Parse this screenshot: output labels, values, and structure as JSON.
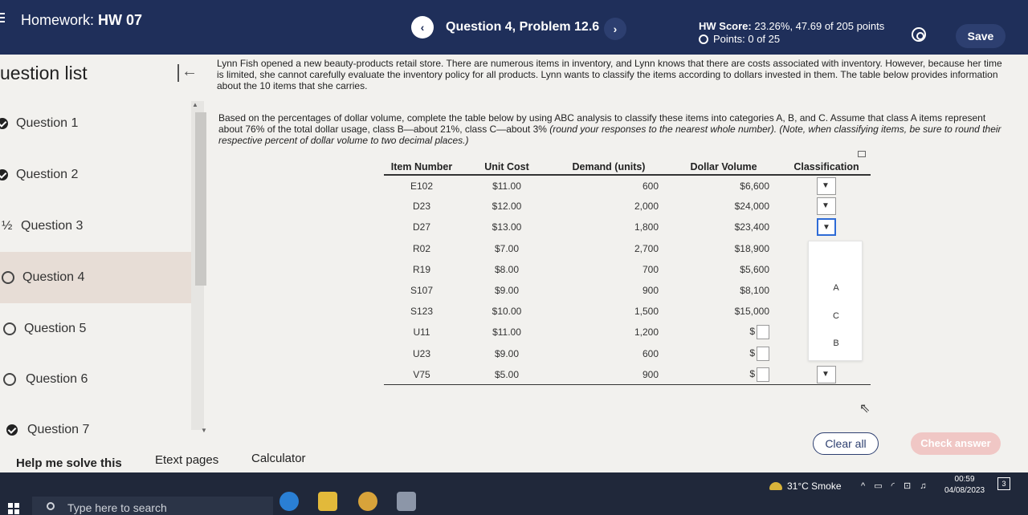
{
  "header": {
    "hw_prefix": "Homework:",
    "hw_name": "HW 07",
    "prev_icon": "‹",
    "next_icon": "›",
    "question_title": "Question 4, Problem 12.6",
    "score_label": "HW Score:",
    "score_value": "23.26%, 47.69 of 205 points",
    "points": "Points: 0 of 25",
    "save_label": "Save",
    "colors": {
      "bar": "#1f2f5a",
      "button": "#2d3f70"
    }
  },
  "sidebar": {
    "title": "uestion list",
    "items": [
      {
        "label": "Question 1",
        "status": "check"
      },
      {
        "label": "Question 2",
        "status": "check"
      },
      {
        "label": "Question 3",
        "status": "partial"
      },
      {
        "label": "Question 4",
        "status": "open"
      },
      {
        "label": "Question 5",
        "status": "open"
      },
      {
        "label": "Question 6",
        "status": "open"
      },
      {
        "label": "Question 7",
        "status": "check"
      }
    ]
  },
  "problem": {
    "para1": "Lynn Fish opened a new beauty-products retail store. There are numerous items in inventory, and Lynn knows that there are costs associated with inventory. However, because her time is limited, she cannot carefully evaluate the inventory policy for all products. Lynn wants to classify the items according to dollars invested in them. The table below provides information about the 10 items that she carries.",
    "para2_main": "Based on the percentages of dollar volume, complete the table below by using ABC analysis to classify these items into categories A, B, and C. Assume that class A items represent about 76% of the total dollar usage, class B—about 21%, class C—about 3% ",
    "para2_italic": "(round your responses to the nearest whole number). (Note, when classifying items, be sure to round their respective percent of dollar volume to two decimal places.)"
  },
  "table": {
    "headers": [
      "Item Number",
      "Unit Cost",
      "Demand (units)",
      "Dollar Volume",
      "Classification"
    ],
    "rows": [
      {
        "item": "E102",
        "cost": "$11.00",
        "demand": "600",
        "volume": "$6,600",
        "cls": "dropdown"
      },
      {
        "item": "D23",
        "cost": "$12.00",
        "demand": "2,000",
        "volume": "$24,000",
        "cls": "dropdown"
      },
      {
        "item": "D27",
        "cost": "$13.00",
        "demand": "1,800",
        "volume": "$23,400",
        "cls": "dropdown-focus"
      },
      {
        "item": "R02",
        "cost": "$7.00",
        "demand": "2,700",
        "volume": "$18,900",
        "cls": ""
      },
      {
        "item": "R19",
        "cost": "$8.00",
        "demand": "700",
        "volume": "$5,600",
        "cls": ""
      },
      {
        "item": "S107",
        "cost": "$9.00",
        "demand": "900",
        "volume": "$8,100",
        "cls": ""
      },
      {
        "item": "S123",
        "cost": "$10.00",
        "demand": "1,500",
        "volume": "$15,000",
        "cls": ""
      },
      {
        "item": "U11",
        "cost": "$11.00",
        "demand": "1,200",
        "volume": "$",
        "cls": ""
      },
      {
        "item": "U23",
        "cost": "$9.00",
        "demand": "600",
        "volume": "$",
        "cls": ""
      },
      {
        "item": "V75",
        "cost": "$5.00",
        "demand": "900",
        "volume": "$",
        "cls": "dropdown"
      }
    ],
    "popup_options": [
      "A",
      "C",
      "B"
    ]
  },
  "footer": {
    "help": "Help me solve this",
    "etext": "Etext pages",
    "calculator": "Calculator",
    "clear": "Clear all",
    "check": "Check answer"
  },
  "taskbar": {
    "search_placeholder": "Type here to search",
    "weather": "31°C  Smoke",
    "time": "00:59",
    "date": "04/08/2023",
    "notif_count": "3"
  }
}
